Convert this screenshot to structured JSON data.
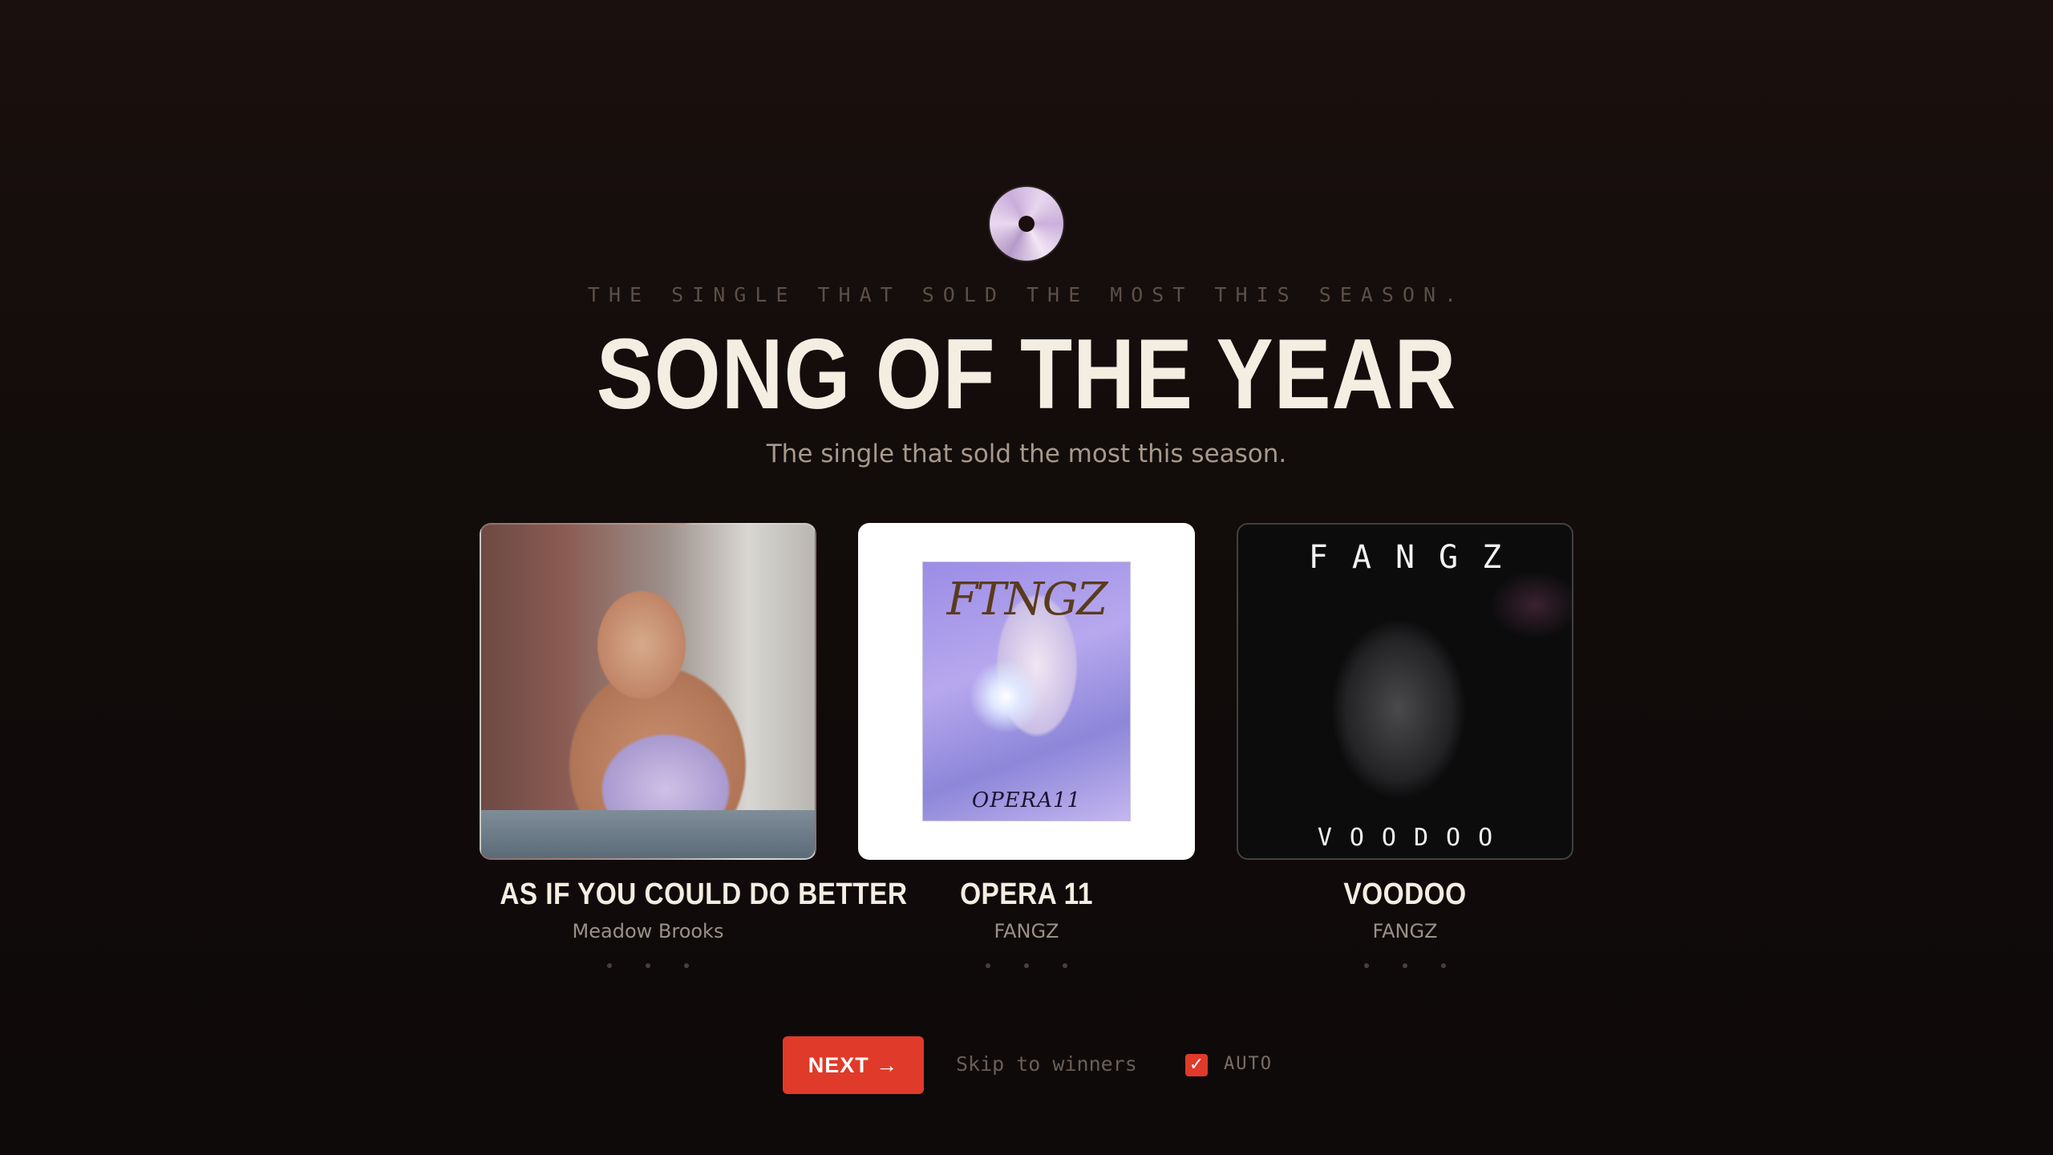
{
  "header": {
    "icon": "disc-icon",
    "eyebrow": "THE SINGLE THAT SOLD THE MOST THIS SEASON.",
    "title": "SONG OF THE YEAR",
    "subtitle": "The single that sold the most this season."
  },
  "nominees": [
    {
      "title": "AS IF YOU COULD DO BETTER",
      "artist": "Meadow Brooks"
    },
    {
      "title": "OPERA 11",
      "artist": "FANGZ",
      "art_top_text": "FTNGZ",
      "art_bottom_text": "OPERA11"
    },
    {
      "title": "VOODOO",
      "artist": "FANGZ",
      "art_top_text": "FANGZ",
      "art_bottom_text": "VOODOO"
    }
  ],
  "controls": {
    "next_label": "NEXT →",
    "skip_label": "Skip to winners",
    "auto_label": "AUTO",
    "auto_checked": true,
    "accent_color": "#e03a2a"
  }
}
